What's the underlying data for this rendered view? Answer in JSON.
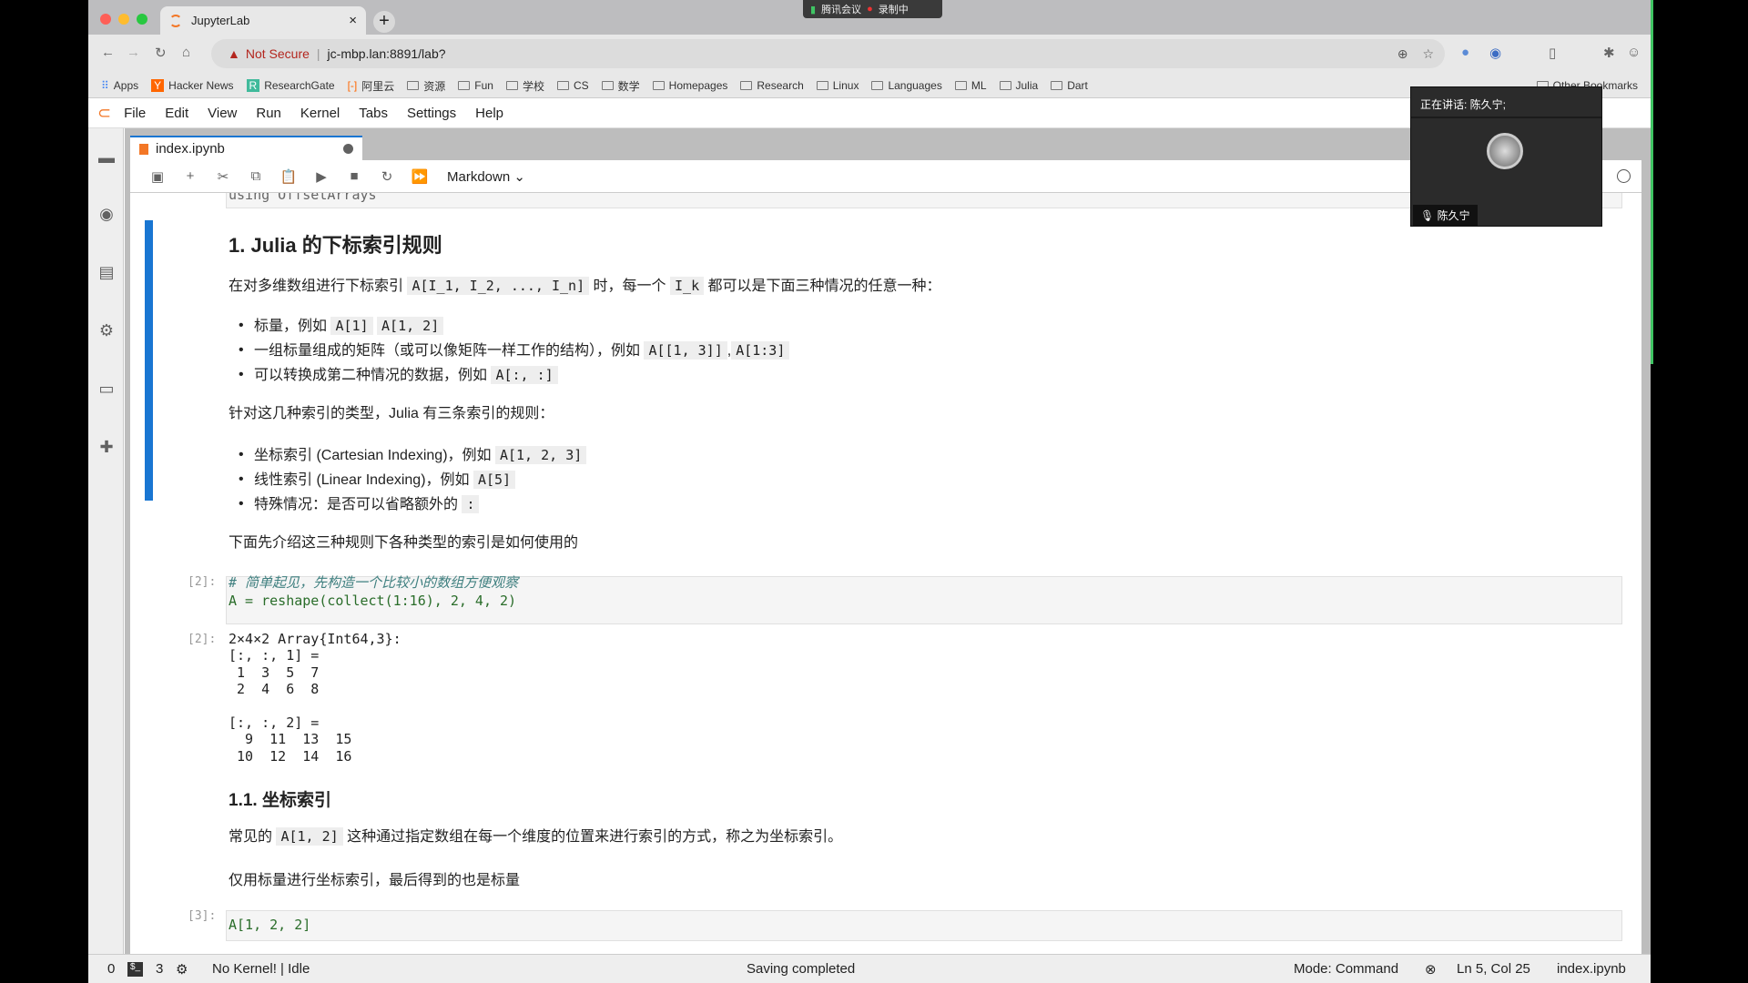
{
  "browser": {
    "tab_title": "JupyterLab",
    "security": "Not Secure",
    "url": "jc-mbp.lan:8891/lab?",
    "bookmarks": [
      "Apps",
      "Hacker News",
      "ResearchGate",
      "阿里云",
      "资源",
      "Fun",
      "学校",
      "CS",
      "数学",
      "Homepages",
      "Research",
      "Linux",
      "Languages",
      "ML",
      "Julia",
      "Dart"
    ],
    "other_bookmarks": "Other Bookmarks"
  },
  "meeting": {
    "app": "腾讯会议",
    "recording": "录制中",
    "speaking": "正在讲话: 陈久宁;",
    "participant": "陈久宁"
  },
  "menu": [
    "File",
    "Edit",
    "View",
    "Run",
    "Kernel",
    "Tabs",
    "Settings",
    "Help"
  ],
  "notebook": {
    "tab": "index.ipynb",
    "cell_type": "Markdown",
    "prev_code": "using OffsetArrays",
    "h1": "1. Julia 的下标索引规则",
    "p1": {
      "a": "在对多维数组进行下标索引 ",
      "c1": "A[I_1, I_2, ..., I_n]",
      "b": " 时，每一个 ",
      "c2": "I_k",
      "d": " 都可以是下面三种情况的任意一种："
    },
    "list1": [
      {
        "t": "标量，例如 ",
        "c1": "A[1]",
        "c2": "A[1, 2]"
      },
      {
        "t": "一组标量组成的矩阵（或可以像矩阵一样工作的结构），例如 ",
        "c1": "A[[1, 3]]",
        "sep": ",",
        "c2": "A[1:3]"
      },
      {
        "t": "可以转换成第二种情况的数据，例如 ",
        "c1": "A[:, :]"
      }
    ],
    "p2": "针对这几种索引的类型，Julia 有三条索引的规则：",
    "list2": [
      {
        "t": "坐标索引 (Cartesian Indexing)，例如 ",
        "c": "A[1, 2, 3]"
      },
      {
        "t": "线性索引 (Linear Indexing)，例如 ",
        "c": "A[5]"
      },
      {
        "t": "特殊情况：是否可以省略额外的 ",
        "c": ":"
      }
    ],
    "p3": "下面先介绍这三种规则下各种类型的索引是如何使用的",
    "cell2": {
      "prompt": "[2]:",
      "comment": "# 简单起见，先构造一个比较小的数组方便观察",
      "code": "A = reshape(collect(1:16), 2, 4, 2)",
      "out_prompt": "[2]:",
      "output": "2×4×2 Array{Int64,3}:\n[:, :, 1] =\n 1  3  5  7\n 2  4  6  8\n\n[:, :, 2] =\n  9  11  13  15\n 10  12  14  16"
    },
    "h2": "1.1. 坐标索引",
    "p4": {
      "a": "常见的 ",
      "c": "A[1, 2]",
      "b": " 这种通过指定数组在每一个维度的位置来进行索引的方式，称之为坐标索引。"
    },
    "p5": "仅用标量进行坐标索引，最后得到的也是标量",
    "cell3": {
      "prompt": "[3]:",
      "code": "A[1, 2, 2]"
    }
  },
  "status": {
    "zero": "0",
    "terminals": "3",
    "kernel": "No Kernel! | Idle",
    "message": "Saving completed",
    "mode": "Mode: Command",
    "position": "Ln 5, Col 25",
    "file": "index.ipynb"
  },
  "colors": {
    "accent": "#1976d2",
    "jupyter_orange": "#f37726",
    "code_green": "#008000",
    "comment": "#408080"
  }
}
